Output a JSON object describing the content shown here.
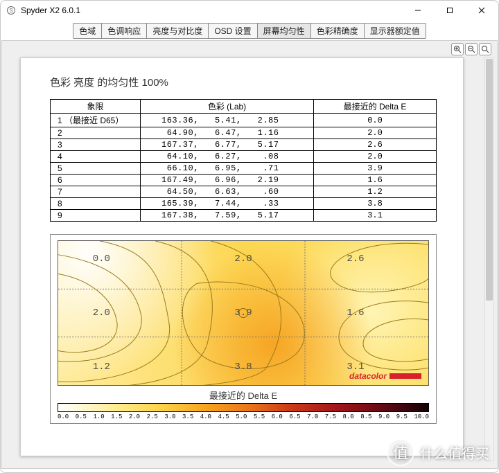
{
  "window": {
    "title": "Spyder X2 6.0.1"
  },
  "tabs": [
    {
      "label": "色域"
    },
    {
      "label": "色调响应"
    },
    {
      "label": "亮度与对比度"
    },
    {
      "label": "OSD 设置"
    },
    {
      "label": "屏幕均匀性",
      "active": true
    },
    {
      "label": "色彩精确度"
    },
    {
      "label": "显示器额定值"
    }
  ],
  "page": {
    "title": "色彩 亮度 的均匀性 100%",
    "table": {
      "headers": [
        "象限",
        "色彩 (Lab)",
        "最接近的 Delta E"
      ],
      "rows": [
        {
          "quad": "1 （最接近 D65）",
          "lab": "163.36,   5.41,   2.85",
          "de": "0.0"
        },
        {
          "quad": "2",
          "lab": " 64.90,   6.47,   1.16",
          "de": "2.0"
        },
        {
          "quad": "3",
          "lab": "167.37,   6.77,   5.17",
          "de": "2.6"
        },
        {
          "quad": "4",
          "lab": " 64.10,   6.27,    .08",
          "de": "2.0"
        },
        {
          "quad": "5",
          "lab": " 66.10,   6.95,    .71",
          "de": "3.9"
        },
        {
          "quad": "6",
          "lab": "167.49,   6.96,   2.19",
          "de": "1.6"
        },
        {
          "quad": "7",
          "lab": " 64.50,   6.63,    .60",
          "de": "1.2"
        },
        {
          "quad": "8",
          "lab": "165.39,   7.44,    .33",
          "de": "3.8"
        },
        {
          "quad": "9",
          "lab": "167.38,   7.59,   5.17",
          "de": "3.1"
        }
      ]
    },
    "brand": "datacolor",
    "legend": {
      "title": "最接近的 Delta E"
    },
    "scale": {
      "ticks": [
        "0.0",
        "0.5",
        "1.0",
        "1.5",
        "2.0",
        "2.5",
        "3.0",
        "3.5",
        "4.0",
        "4.5",
        "5.0",
        "5.5",
        "6.0",
        "6.5",
        "7.0",
        "7.5",
        "8.0",
        "8.5",
        "9.0",
        "9.5",
        "10.0"
      ]
    }
  },
  "watermark": {
    "symbol": "值",
    "text": "什么值得买"
  },
  "chart_data": {
    "type": "heatmap",
    "title": "色彩 亮度 的均匀性 100%",
    "legend_title": "最接近的 Delta E",
    "grid": {
      "rows": 3,
      "cols": 3
    },
    "cells": [
      {
        "row": 0,
        "col": 0,
        "value": 0.0
      },
      {
        "row": 0,
        "col": 1,
        "value": 2.0
      },
      {
        "row": 0,
        "col": 2,
        "value": 2.6
      },
      {
        "row": 1,
        "col": 0,
        "value": 2.0
      },
      {
        "row": 1,
        "col": 1,
        "value": 3.9
      },
      {
        "row": 1,
        "col": 2,
        "value": 1.6
      },
      {
        "row": 2,
        "col": 0,
        "value": 1.2
      },
      {
        "row": 2,
        "col": 1,
        "value": 3.8
      },
      {
        "row": 2,
        "col": 2,
        "value": 3.1
      }
    ],
    "color_scale": {
      "min": 0.0,
      "max": 10.0,
      "step": 0.5
    }
  }
}
